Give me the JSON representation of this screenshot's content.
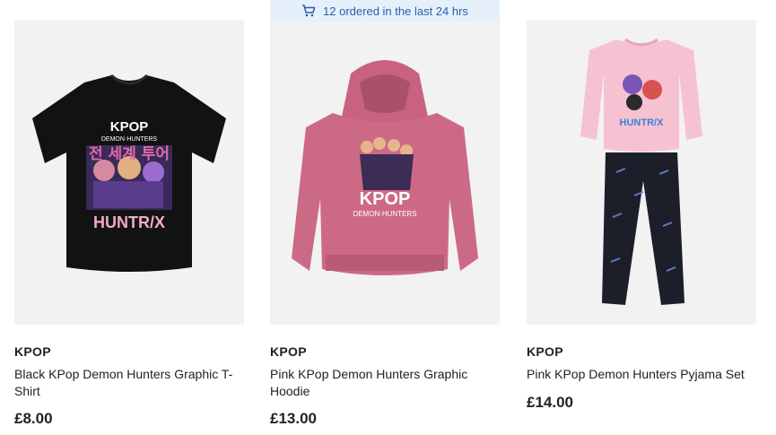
{
  "badge": {
    "icon": "cart-icon",
    "text": "12 ordered in the last 24 hrs",
    "color": "#2a5fa8",
    "bg": "#e6f0fb"
  },
  "products": [
    {
      "brand": "KPOP",
      "name": "Black KPop Demon Hunters Graphic T-Shirt",
      "price": "£8.00",
      "print_lines": [
        "KPOP",
        "DEMON·HUNTERS",
        "전 세계 투어",
        "HUNTR/X"
      ]
    },
    {
      "brand": "KPOP",
      "name": "Pink KPop Demon Hunters Graphic Hoodie",
      "price": "£13.00",
      "print_lines": [
        "KPOP",
        "DEMON·HUNTERS"
      ]
    },
    {
      "brand": "KPOP",
      "name": "Pink KPop Demon Hunters Pyjama Set",
      "price": "£14.00",
      "print_lines": [
        "HUNTR/X"
      ]
    }
  ]
}
